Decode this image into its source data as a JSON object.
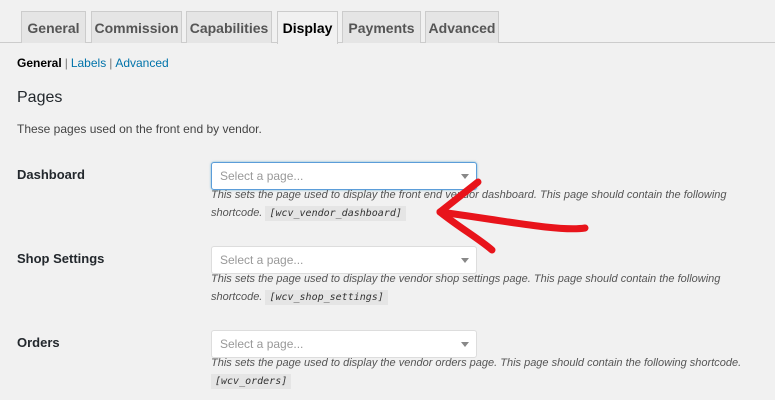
{
  "tabs": [
    {
      "label": "General"
    },
    {
      "label": "Commission"
    },
    {
      "label": "Capabilities"
    },
    {
      "label": "Display"
    },
    {
      "label": "Payments"
    },
    {
      "label": "Advanced"
    }
  ],
  "subnav": {
    "current": "General",
    "items": [
      "Labels",
      "Advanced"
    ],
    "separator": "|"
  },
  "section": {
    "title": "Pages",
    "intro": "These pages used on the front end by vendor."
  },
  "fields": [
    {
      "label": "Dashboard",
      "placeholder": "Select a page...",
      "desc_line1": "This sets the page used to display the front end vendor dashboard. This page should contain the following",
      "desc_prefix": "shortcode.",
      "shortcode": "[wcv_vendor_dashboard]"
    },
    {
      "label": "Shop Settings",
      "placeholder": "Select a page...",
      "desc_line1": "This sets the page used to display the vendor shop settings page. This page should contain the following",
      "desc_prefix": "shortcode.",
      "shortcode": "[wcv_shop_settings]"
    },
    {
      "label": "Orders",
      "placeholder": "Select a page...",
      "desc_line1": "This sets the page used to display the vendor orders page. This page should contain the following shortcode.",
      "desc_prefix": "",
      "shortcode": "[wcv_orders]"
    }
  ],
  "colors": {
    "accent": "#0073aa",
    "annotation_arrow": "#e8141b",
    "focus_border": "#5b9dd9"
  },
  "icons": {
    "select_caret": "caret-down-icon",
    "annotation": "red-arrow-annotation"
  }
}
